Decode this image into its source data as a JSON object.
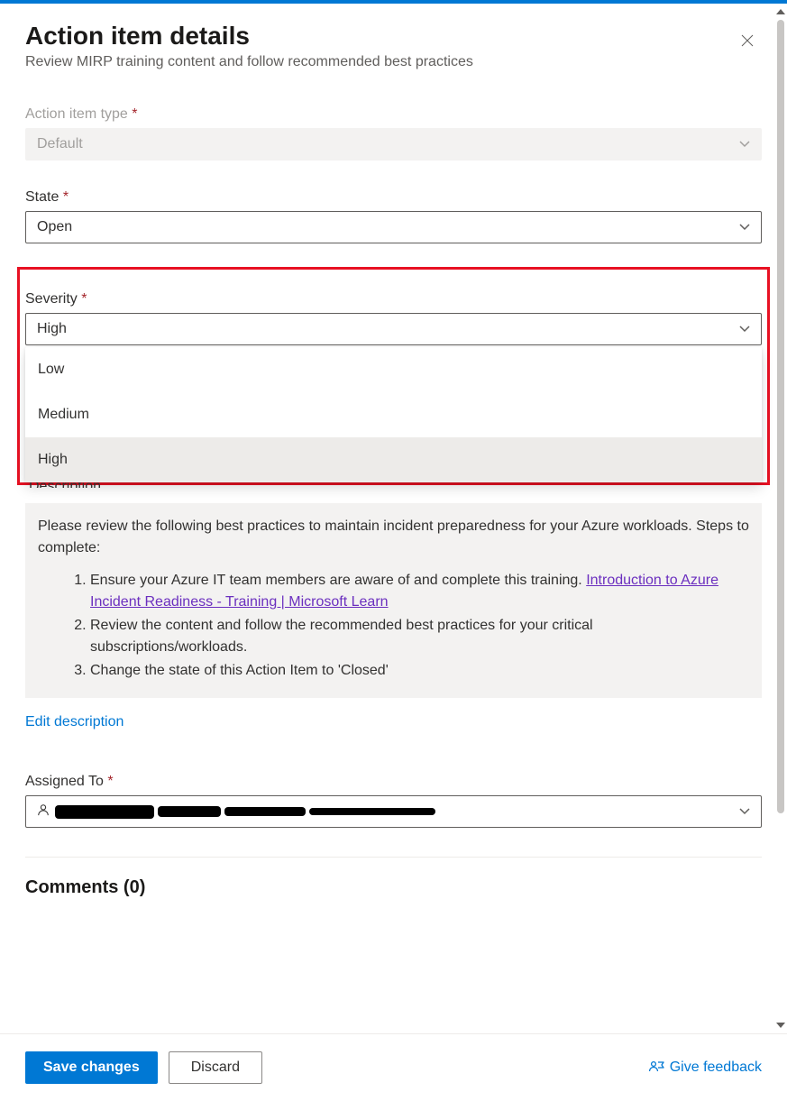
{
  "header": {
    "title": "Action item details",
    "subtitle": "Review MIRP training content and follow recommended best practices",
    "close_icon": "×"
  },
  "fields": {
    "action_item_type": {
      "label": "Action item type",
      "value": "Default"
    },
    "state": {
      "label": "State",
      "value": "Open"
    },
    "severity": {
      "label": "Severity",
      "value": "High",
      "options": [
        "Low",
        "Medium",
        "High"
      ]
    },
    "description": {
      "label_fragment": "Description",
      "intro": "Please review the following best practices to maintain incident preparedness for your Azure workloads. Steps to complete:",
      "steps": {
        "s1": "Ensure your Azure IT team members are aware of and complete this training.",
        "s1_link": "Introduction to Azure Incident Readiness - Training | Microsoft Learn",
        "s2": "Review the content and follow the recommended best practices for your critical subscriptions/workloads.",
        "s3": "Change the state of this Action Item to 'Closed'"
      },
      "edit_link": "Edit description"
    },
    "assigned_to": {
      "label": "Assigned To"
    }
  },
  "comments": {
    "heading": "Comments (0)"
  },
  "footer": {
    "save": "Save changes",
    "discard": "Discard",
    "feedback": "Give feedback"
  }
}
